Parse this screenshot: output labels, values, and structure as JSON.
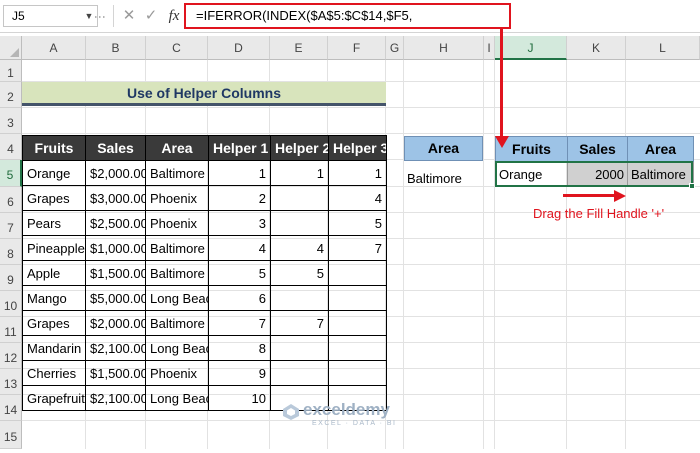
{
  "formula_bar": {
    "name_box": "J5",
    "cancel_icon": "✕",
    "enter_icon": "✓",
    "fx_label": "fx",
    "formula": "=IFERROR(INDEX($A$5:$C$14,$F5,"
  },
  "columns": [
    "A",
    "B",
    "C",
    "D",
    "E",
    "F",
    "G",
    "H",
    "I",
    "J",
    "K",
    "L"
  ],
  "rows": [
    "1",
    "2",
    "3",
    "4",
    "5",
    "6",
    "7",
    "8",
    "9",
    "10",
    "11",
    "12",
    "13",
    "14",
    "15"
  ],
  "title": "Use of Helper Columns",
  "table": {
    "headers": [
      "Fruits",
      "Sales",
      "Area",
      "Helper 1",
      "Helper 2",
      "Helper 3"
    ],
    "rows": [
      [
        "Orange",
        "$2,000.00",
        "Baltimore",
        "1",
        "1",
        "1"
      ],
      [
        "Grapes",
        "$3,000.00",
        "Phoenix",
        "2",
        "",
        "4"
      ],
      [
        "Pears",
        "$2,500.00",
        "Phoenix",
        "3",
        "",
        "5"
      ],
      [
        "Pineapple",
        "$1,000.00",
        "Baltimore",
        "4",
        "4",
        "7"
      ],
      [
        "Apple",
        "$1,500.00",
        "Baltimore",
        "5",
        "5",
        ""
      ],
      [
        "Mango",
        "$5,000.00",
        "Long Beach",
        "6",
        "",
        ""
      ],
      [
        "Grapes",
        "$2,000.00",
        "Baltimore",
        "7",
        "7",
        ""
      ],
      [
        "Mandarin",
        "$2,100.00",
        "Long Beach",
        "8",
        "",
        ""
      ],
      [
        "Cherries",
        "$1,500.00",
        "Phoenix",
        "9",
        "",
        ""
      ],
      [
        "Grapefruit",
        "$2,100.00",
        "Long Beach",
        "10",
        "",
        ""
      ]
    ]
  },
  "criteria": {
    "header": "Area",
    "value": "Baltimore"
  },
  "result": {
    "headers": [
      "Fruits",
      "Sales",
      "Area"
    ],
    "row": [
      "Orange",
      "2000",
      "Baltimore"
    ]
  },
  "annotation": {
    "text": "Drag the Fill Handle '+'"
  },
  "watermark": {
    "name": "exceldemy",
    "tagline": "EXCEL · DATA · BI"
  },
  "colors": {
    "accent_red": "#e0141e",
    "excel_green": "#217346",
    "title_bg": "#d8e4bc",
    "header_dark": "#3a3a3a",
    "header_blue": "#9dc3e6"
  }
}
